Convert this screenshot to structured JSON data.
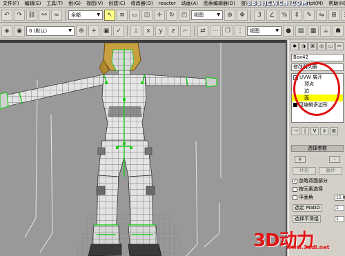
{
  "menu": [
    "文件(F)",
    "编辑(E)",
    "工具(T)",
    "组(G)",
    "视图(V)",
    "创建(C)",
    "修改器(O)",
    "reactor",
    "动画(A)",
    "图表编辑器(D)",
    "渲染(R)",
    "自定义(U)",
    "MAXScript(M)",
    "帮助(H)"
  ],
  "watermark": "BBS.JCWCN.COM",
  "toolbar1": {
    "selection_filter": "全部",
    "reference_coord": "视图"
  },
  "toolbar2": {
    "layer_name": "0 (默认)",
    "view_select": "视图"
  },
  "panel": {
    "object_name": "Box42",
    "modifier_list": "修改器列表",
    "stack": [
      {
        "label": "UVW 展开",
        "type": "parent"
      },
      {
        "label": "顶点",
        "type": "sub"
      },
      {
        "label": "边",
        "type": "sub"
      },
      {
        "label": "面",
        "type": "sub-selected"
      },
      {
        "label": "可编辑多边形",
        "type": "base"
      }
    ],
    "rollout_title": "选择参数",
    "plus": "+",
    "minus": "-",
    "ring_btn": "环形",
    "loop_btn": "循环",
    "checks": [
      {
        "label": "忽略背面部分",
        "checked": true
      },
      {
        "label": "按元素选择",
        "checked": false
      },
      {
        "label": "平面角",
        "checked": false
      }
    ],
    "plane_value": "15.0",
    "select_matid_btn": "选定 MatID",
    "matid_value": "1",
    "select_smooth_btn": "选择平滑组",
    "smooth_value": "1"
  },
  "logo": {
    "main": "3D动力",
    "sub": "www.3ddl.net"
  },
  "colors": {
    "viewport_bg": "#999999",
    "mesh_fill": "#e8e8e8",
    "seam_green": "#22cc22",
    "highlight": "#ffff00",
    "annotation_red": "#e01010"
  }
}
